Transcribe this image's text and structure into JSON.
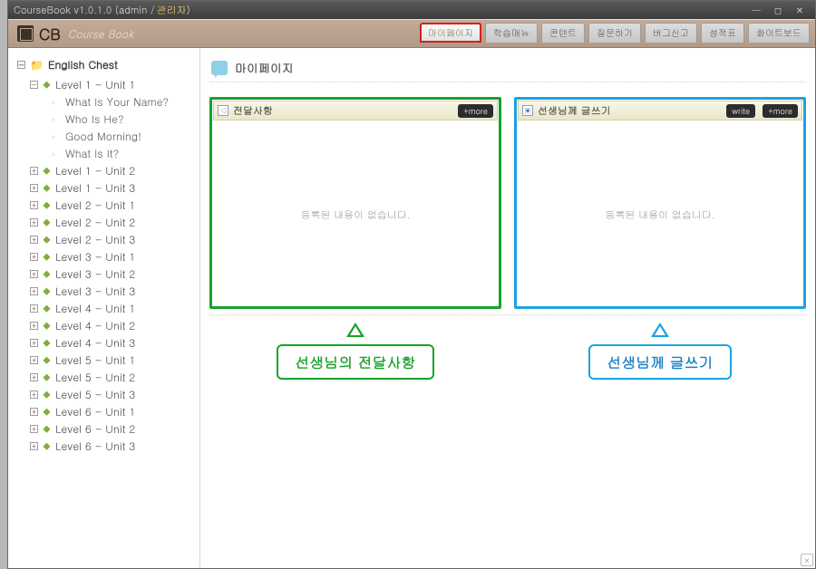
{
  "window": {
    "title_prefix": "CourseBook v1.0.1.0 (admin / ",
    "title_role": "관리자",
    "title_suffix": ")"
  },
  "brand": {
    "logo": "CB",
    "subtitle": "Course Book"
  },
  "topnav": {
    "items": [
      {
        "label": "마이페이지",
        "active": true
      },
      {
        "label": "학습매뉴"
      },
      {
        "label": "콘텐트"
      },
      {
        "label": "질문하기"
      },
      {
        "label": "버그신고"
      },
      {
        "label": "성적표"
      },
      {
        "label": "화이트보드"
      }
    ]
  },
  "sidebar": {
    "root": "English Chest",
    "expanded_unit": {
      "label": "Level 1 - Unit 1",
      "pages": [
        "What Is Your Name?",
        "Who Is He?",
        "Good Morning!",
        "What Is It?"
      ]
    },
    "units": [
      "Level 1 - Unit 2",
      "Level 1 - Unit 3",
      "Level 2 - Unit 1",
      "Level 2 - Unit 2",
      "Level 2 - Unit 3",
      "Level 3 - Unit 1",
      "Level 3 - Unit 2",
      "Level 3 - Unit 3",
      "Level 4 - Unit 1",
      "Level 4 - Unit 2",
      "Level 4 - Unit 3",
      "Level 5 - Unit 1",
      "Level 5 - Unit 2",
      "Level 5 - Unit 3",
      "Level 6 - Unit 1",
      "Level 6 - Unit 2",
      "Level 6 - Unit 3"
    ]
  },
  "page": {
    "title": "마이페이지",
    "panels": {
      "left": {
        "title": "전달사항",
        "empty": "등록된 내용이 없습니다.",
        "buttons": [
          "+more"
        ]
      },
      "right": {
        "title": "선생님께 글쓰기",
        "empty": "등록된 내용이 없습니다.",
        "buttons": [
          "write",
          "+more"
        ]
      }
    },
    "callouts": {
      "left": "선생님의 전달사항",
      "right": "선생님께 글쓰기"
    },
    "hint_close": "×"
  }
}
